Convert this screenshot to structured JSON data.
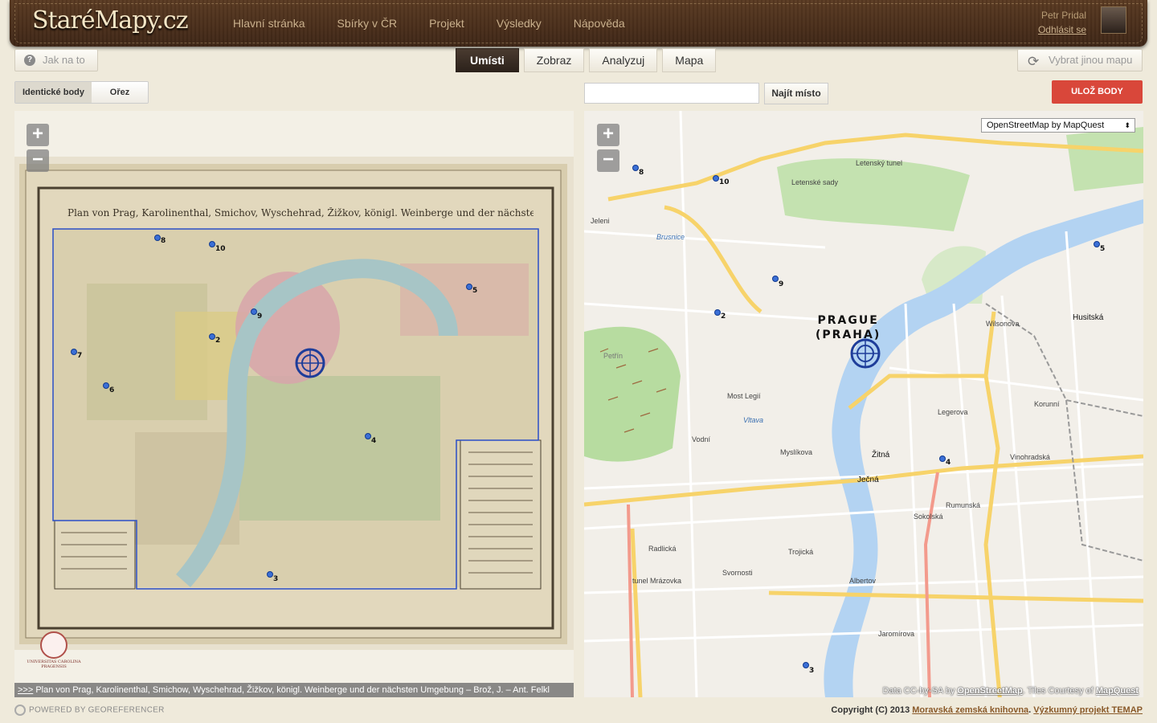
{
  "header": {
    "logo": "StaréMapy.cz",
    "nav": [
      "Hlavní stránka",
      "Sbírky v ČR",
      "Projekt",
      "Výsledky",
      "Nápověda"
    ],
    "user_name": "Petr Pridal",
    "logout": "Odhlásit se"
  },
  "toolbar": {
    "howto": "Jak na to",
    "tabs": [
      "Umísti",
      "Zobraz",
      "Analyzuj",
      "Mapa"
    ],
    "active_tab": "Umísti",
    "other_map": "Vybrat jinou mapu"
  },
  "left": {
    "segments": [
      "Identické body",
      "Ořez"
    ],
    "map_title": "Plan von Prag, Karolinenthal, Smichov, Wyschehrad, Žižkov, königl. Weinberge und der nächsten Umgebung.",
    "seal_text": "UNIVERSITAS CAROLINA PRAGENSIS",
    "caption_link": ">>>",
    "caption": "Plan von Prag, Karolinenthal, Smichow, Wyschehrad, Žižkov, königl. Weinberge und der nächsten Umgebung – Brož, J. – Ant. Felkl",
    "points": [
      "8",
      "10",
      "5",
      "9",
      "2",
      "7",
      "6",
      "4",
      "3"
    ]
  },
  "right": {
    "search_placeholder": "",
    "find_button": "Najít místo",
    "save_button": "ULOŽ BODY",
    "layer": "OpenStreetMap by MapQuest",
    "city_label": "PRAGUE",
    "city_sub": "(PRAHA)",
    "points": [
      "8",
      "10",
      "5",
      "9",
      "2",
      "4",
      "3"
    ],
    "streets": [
      "Letenské sady",
      "Brusnice",
      "Vltava",
      "Most Legií",
      "Ječná",
      "Žitná",
      "Wilsonova",
      "Sokolská",
      "Husitská",
      "Petřín",
      "Letenský tunel",
      "Jeleni",
      "Vodní",
      "Myslíkova",
      "Trojická",
      "Svornosti",
      "Radlická",
      "tunel Mrázovka",
      "Vinohradská",
      "Legerova",
      "Rumunská",
      "Korunní",
      "Albertov",
      "Jaromírova"
    ],
    "attribution_prefix": "Data CC-by-SA by",
    "attribution_osm": "OpenStreetMap",
    "attribution_mid": ". Tiles Courtesy of",
    "attribution_mq": "MapQuest"
  },
  "footer": {
    "powered": "POWERED BY GEOREFERENCER",
    "copyright": "Copyright (C) 2013",
    "mzk": "Moravská zemská knihovna",
    "temap": "Výzkumný projekt TEMAP"
  },
  "colors": {
    "accent_red": "#d9473a",
    "marker_blue": "#3b6fd6",
    "header_brown": "#4a2f1c"
  }
}
